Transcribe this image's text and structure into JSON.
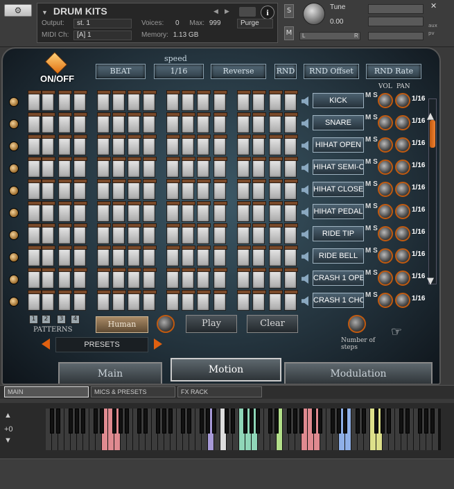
{
  "header": {
    "title": "DRUM KITS",
    "output_label": "Output:",
    "output_value": "st. 1",
    "voices_label": "Voices:",
    "voices_value": "0",
    "max_label": "Max:",
    "max_value": "999",
    "purge_label": "Purge",
    "midi_label": "MIDI Ch:",
    "midi_value": "[A]  1",
    "memory_label": "Memory:",
    "memory_value": "1.13 GB",
    "s_label": "S",
    "m_label": "M",
    "tune_label": "Tune",
    "tune_value": "0.00",
    "pan_left": "L",
    "pan_right": "R",
    "aux_label": "aux",
    "pv_label": "pv"
  },
  "controls": {
    "onoff": "ON/OFF",
    "beat": "BEAT",
    "speed_label": "speed",
    "speed_value": "1/16",
    "reverse": "Reverse",
    "rnd": "RND",
    "rnd_offset": "RND Offset",
    "rnd_rate": "RND Rate",
    "vol_label": "VOL",
    "pan_label": "PAN"
  },
  "rows": [
    {
      "name": "KICK",
      "steps": "1/16",
      "ms": "M S"
    },
    {
      "name": "SNARE",
      "steps": "1/16",
      "ms": "M S"
    },
    {
      "name": "HIHAT OPEN",
      "steps": "1/16",
      "ms": "M S"
    },
    {
      "name": "HIHAT SEMI-C",
      "steps": "1/16",
      "ms": "M S"
    },
    {
      "name": "HIHAT CLOSE",
      "steps": "1/16",
      "ms": "M S"
    },
    {
      "name": "HIHAT PEDAL",
      "steps": "1/16",
      "ms": "M S"
    },
    {
      "name": "RIDE TIP",
      "steps": "1/16",
      "ms": "M S"
    },
    {
      "name": "RIDE BELL",
      "steps": "1/16",
      "ms": "M S"
    },
    {
      "name": "CRASH 1 OPE",
      "steps": "1/16",
      "ms": "M S"
    },
    {
      "name": "CRASH 1 CHO",
      "steps": "1/16",
      "ms": "M S"
    }
  ],
  "patterns": {
    "label": "PATTERNS",
    "items": [
      "1",
      "2",
      "3",
      "4"
    ]
  },
  "buttons": {
    "human": "Human",
    "play": "Play",
    "clear": "Clear"
  },
  "presets": {
    "label": "PRESETS"
  },
  "number_of_steps": "Number of steps",
  "tabs": {
    "main": "Main",
    "motion": "Motion",
    "modulation": "Modulation"
  },
  "bottom_tabs": [
    "MAIN",
    "MICS & PRESETS",
    "FX RACK"
  ],
  "keyboard": {
    "octave": "+0"
  }
}
